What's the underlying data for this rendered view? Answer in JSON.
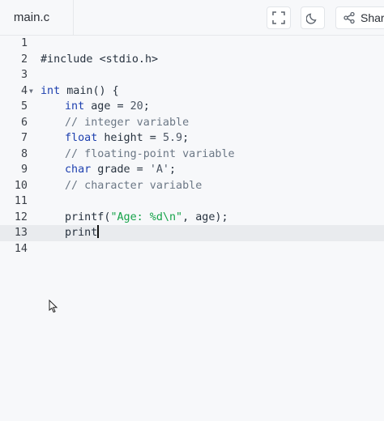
{
  "tab": {
    "filename": "main.c"
  },
  "toolbar": {
    "fullscreen_icon": "fullscreen-icon",
    "theme_icon": "moon-icon",
    "share_icon": "share-icon",
    "share_label": "Shar"
  },
  "editor": {
    "active_line": 13,
    "lines": [
      {
        "n": "1"
      },
      {
        "n": "2",
        "t1": "#include ",
        "t2": "<stdio.h>"
      },
      {
        "n": "3"
      },
      {
        "n": "4",
        "kw": "int",
        "rest": " main() {"
      },
      {
        "n": "5",
        "kw": "int",
        "rest": " age = ",
        "num": "20",
        "end": ";"
      },
      {
        "n": "6",
        "cm": "// integer variable"
      },
      {
        "n": "7",
        "kw": "float",
        "rest": " height = ",
        "num": "5.9",
        "end": ";"
      },
      {
        "n": "8",
        "cm": "// floating-point variable"
      },
      {
        "n": "9",
        "kw": "char",
        "rest": " grade = ",
        "num": "'A'",
        "end": ";"
      },
      {
        "n": "10",
        "cm": "// character variable"
      },
      {
        "n": "11"
      },
      {
        "n": "12",
        "fn": "printf(",
        "str": "\"Age: %d\\n\"",
        "rest": ", age);"
      },
      {
        "n": "13",
        "typed": "print"
      },
      {
        "n": "14"
      }
    ]
  }
}
